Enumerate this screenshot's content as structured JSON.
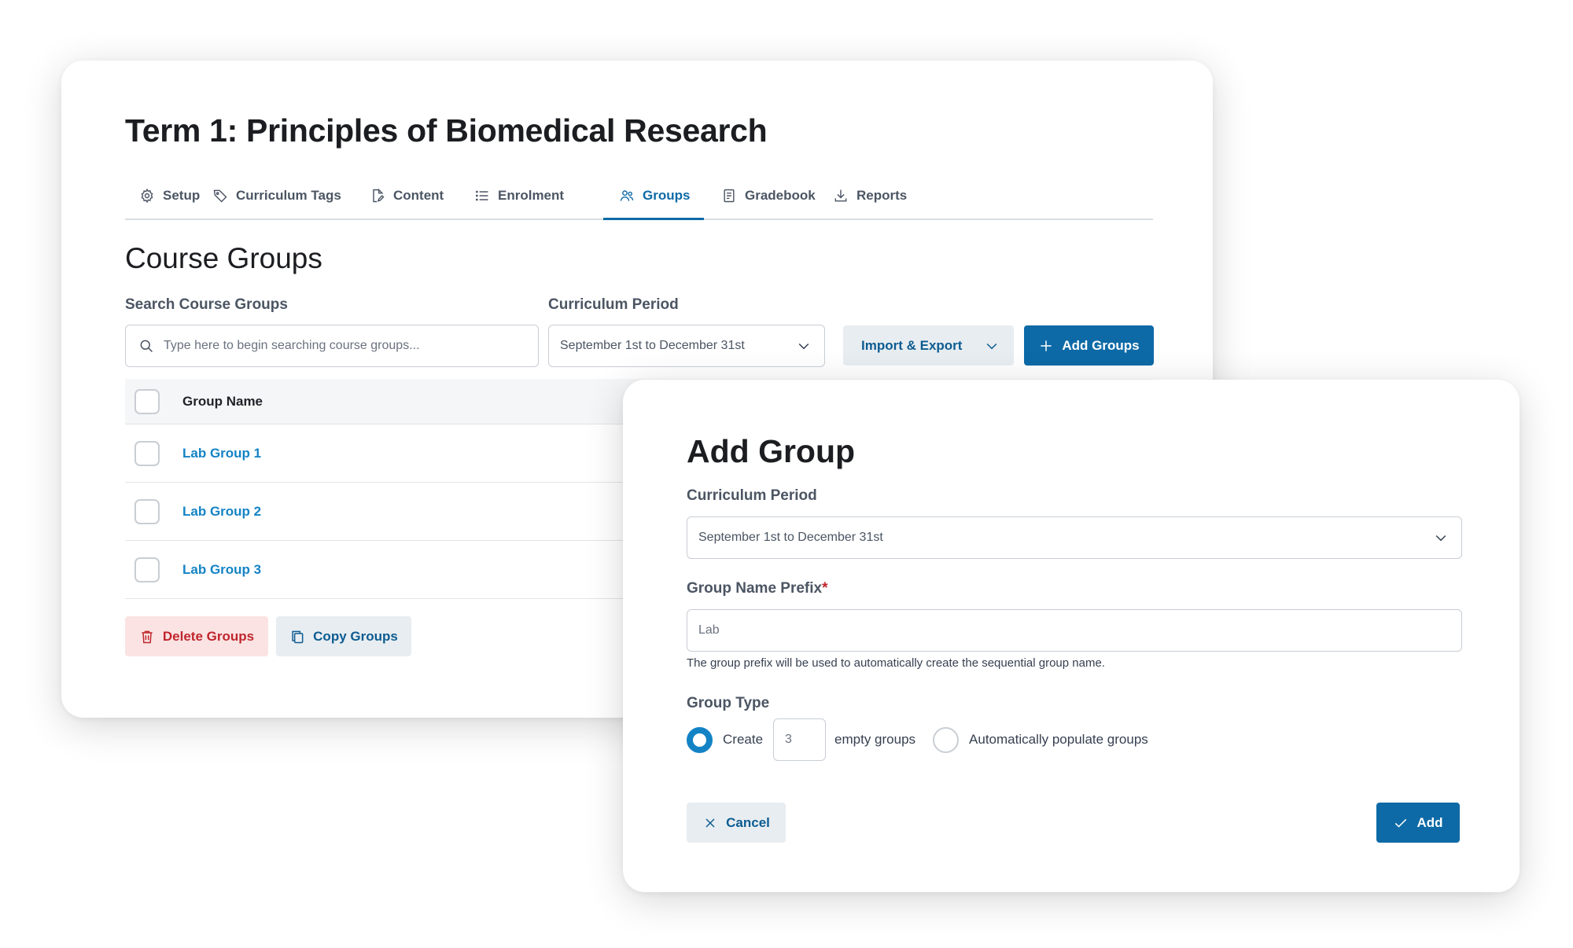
{
  "course": {
    "title": "Term 1: Principles of Biomedical Research",
    "tabs": [
      {
        "label": "Setup",
        "icon": "gear-icon"
      },
      {
        "label": "Curriculum Tags",
        "icon": "tag-icon"
      },
      {
        "label": "Content",
        "icon": "document-edit-icon"
      },
      {
        "label": "Enrolment",
        "icon": "list-icon"
      },
      {
        "label": "Groups",
        "icon": "users-icon",
        "active": true
      },
      {
        "label": "Gradebook",
        "icon": "gradebook-icon"
      },
      {
        "label": "Reports",
        "icon": "download-icon"
      }
    ]
  },
  "groups_page": {
    "section_title": "Course Groups",
    "search": {
      "label": "Search Course Groups",
      "placeholder": "Type here to begin searching course groups..."
    },
    "period": {
      "label": "Curriculum Period",
      "value": "September 1st to December 31st"
    },
    "import_export_label": "Import & Export",
    "add_groups_label": "Add Groups",
    "table": {
      "header": "Group Name",
      "rows": [
        "Lab Group 1",
        "Lab Group 2",
        "Lab Group 3"
      ]
    },
    "delete_label": "Delete Groups",
    "copy_label": "Copy Groups"
  },
  "modal": {
    "title": "Add Group",
    "period": {
      "label": "Curriculum Period",
      "value": "September 1st to December 31st"
    },
    "prefix": {
      "label": "Group Name Prefix",
      "required_mark": "*",
      "value": "Lab",
      "help": "The group prefix will be used to automatically create the sequential group name."
    },
    "group_type": {
      "label": "Group Type",
      "create_label": "Create",
      "count": "3",
      "empty_groups_label": "empty groups",
      "auto_label": "Automatically populate groups",
      "selected": "create"
    },
    "cancel_label": "Cancel",
    "add_label": "Add"
  },
  "colors": {
    "primary": "#0d6aa6",
    "link": "#1483c5",
    "danger": "#c0262d",
    "danger_bg": "#fbe3e3",
    "secondary_bg": "#e8edf1"
  }
}
